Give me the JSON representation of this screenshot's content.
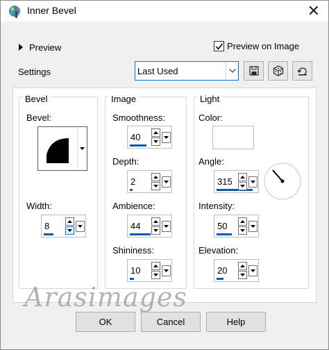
{
  "window": {
    "title": "Inner Bevel"
  },
  "preview": {
    "toggle_label": "Preview",
    "checkbox_label": "Preview on Image",
    "checked": true
  },
  "settings": {
    "label": "Settings",
    "preset_value": "Last Used"
  },
  "groups": {
    "bevel": {
      "label": "Bevel",
      "bevel_label": "Bevel:",
      "width_label": "Width:",
      "width_value": "8"
    },
    "image": {
      "label": "Image",
      "smoothness_label": "Smoothness:",
      "smoothness_value": "40",
      "depth_label": "Depth:",
      "depth_value": "2",
      "ambience_label": "Ambience:",
      "ambience_value": "44",
      "shininess_label": "Shininess:",
      "shininess_value": "10"
    },
    "light": {
      "label": "Light",
      "color_label": "Color:",
      "color_value": "#ffffff",
      "angle_label": "Angle:",
      "angle_value": "315",
      "intensity_label": "Intensity:",
      "intensity_value": "50",
      "elevation_label": "Elevation:",
      "elevation_value": "20"
    }
  },
  "watermark": "Arasimages",
  "buttons": {
    "ok": "OK",
    "cancel": "Cancel",
    "help": "Help"
  }
}
